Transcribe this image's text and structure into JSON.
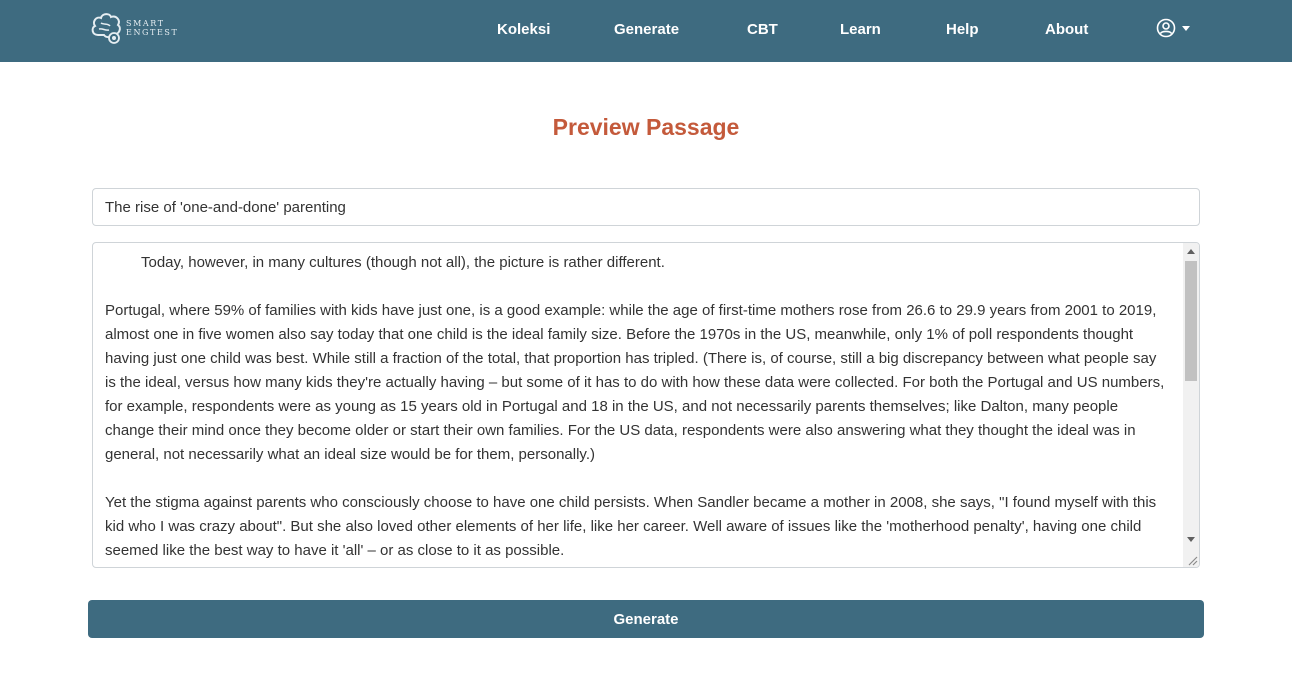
{
  "brand": {
    "logo_line1": "SMART",
    "logo_line2": "ENGTEST"
  },
  "nav": {
    "items": [
      {
        "label": "Koleksi"
      },
      {
        "label": "Generate"
      },
      {
        "label": "CBT"
      },
      {
        "label": "Learn"
      },
      {
        "label": "Help"
      },
      {
        "label": "About"
      }
    ]
  },
  "icons": {
    "logo": "brain-logo-icon",
    "user": "user-circle-icon",
    "caret": "caret-down-icon"
  },
  "colors": {
    "navbar": "#3e6b80",
    "title": "#c45a3b",
    "button": "#3e6b80"
  },
  "page": {
    "title": "Preview Passage"
  },
  "form": {
    "passage_title": "The rise of 'one-and-done' parenting",
    "paragraphs": [
      "Today, however, in many cultures (though not all), the picture is rather different.",
      "Portugal, where 59% of families with kids have just one, is a good example: while the age of first-time mothers rose from 26.6 to 29.9 years from 2001 to 2019, almost one in five women also say today that one child is the ideal family size. Before the 1970s in the US, meanwhile, only 1% of poll respondents thought having just one child was best. While still a fraction of the total, that proportion has tripled. (There is, of course, still a big discrepancy between what people say is the ideal, versus how many kids they're actually having – but some of it has to do with how these data were collected. For both the Portugal and US numbers, for example, respondents were as young as 15 years old in Portugal and 18 in the US, and not necessarily parents themselves; like Dalton, many people change their mind once they become older or start their own families. For the US data, respondents were also answering what they thought the ideal was in general, not necessarily what an ideal size would be for them, personally.)",
      "Yet the stigma against parents who consciously choose to have one child persists. When Sandler became a mother in 2008, she says, \"I found myself with this kid who I was crazy about\". But she also loved other elements of her life, like her career. Well aware of issues like the 'motherhood penalty', having one child seemed like the best way to have it 'all' – or as close to it as possible."
    ],
    "generate_label": "Generate"
  }
}
